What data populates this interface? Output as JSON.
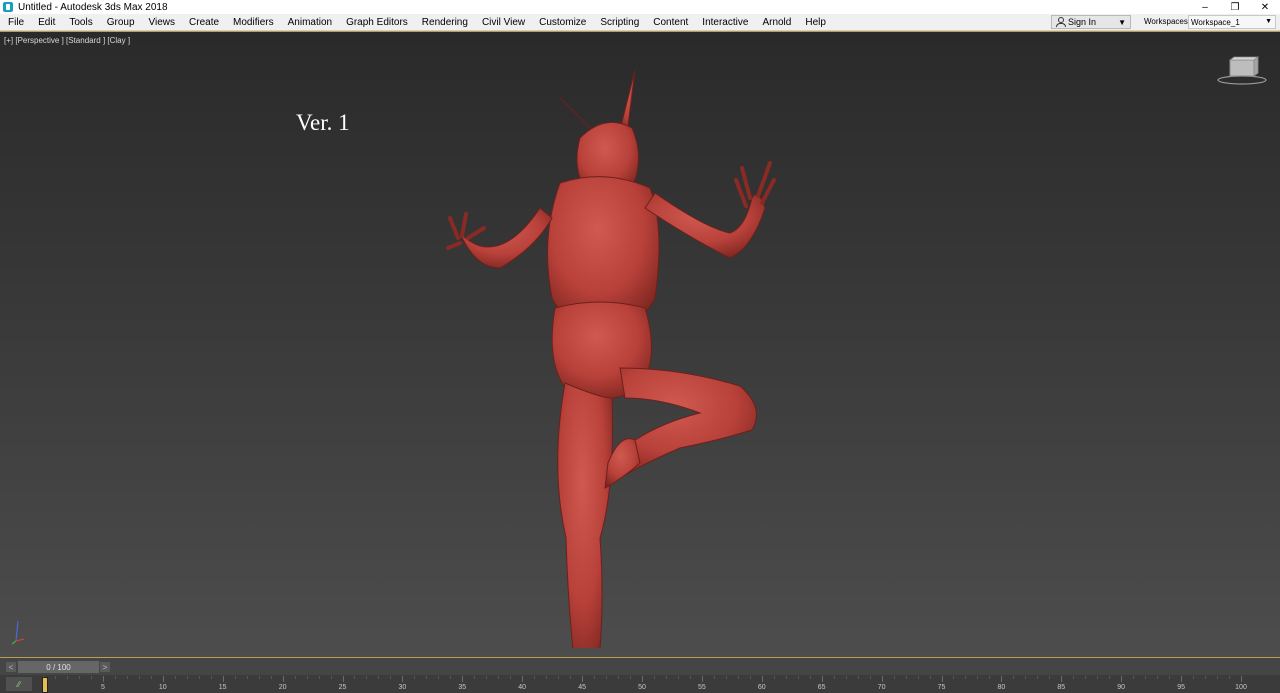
{
  "window": {
    "title": "Untitled - Autodesk 3ds Max 2018",
    "icon": "3ds-max-app-icon",
    "controls": [
      "–",
      "❐",
      "✕"
    ]
  },
  "menubar": {
    "items": [
      "File",
      "Edit",
      "Tools",
      "Group",
      "Views",
      "Create",
      "Modifiers",
      "Animation",
      "Graph Editors",
      "Rendering",
      "Civil View",
      "Customize",
      "Scripting",
      "Content",
      "Interactive",
      "Arnold",
      "Help"
    ],
    "signin_label": "Sign In",
    "workspaces_label": "Workspaces:",
    "workspace_value": "Workspace_1"
  },
  "viewport": {
    "label": "[+] [Perspective ] [Standard ] [Clay ]",
    "annotation_text": "Ver. 1",
    "background_top": "#2a2a2a",
    "background_bottom": "#4d4d4d",
    "active_border_color": "#b9a14a",
    "model_color": "#b8413a"
  },
  "timeslider": {
    "value": "0 / 100",
    "prev_label": "<",
    "next_label": ">"
  },
  "trackbar": {
    "ticks": [
      0,
      5,
      10,
      15,
      20,
      25,
      30,
      35,
      40,
      45,
      50,
      55,
      60,
      65,
      70,
      75,
      80,
      85,
      90,
      95,
      100
    ],
    "current_frame": 0
  }
}
